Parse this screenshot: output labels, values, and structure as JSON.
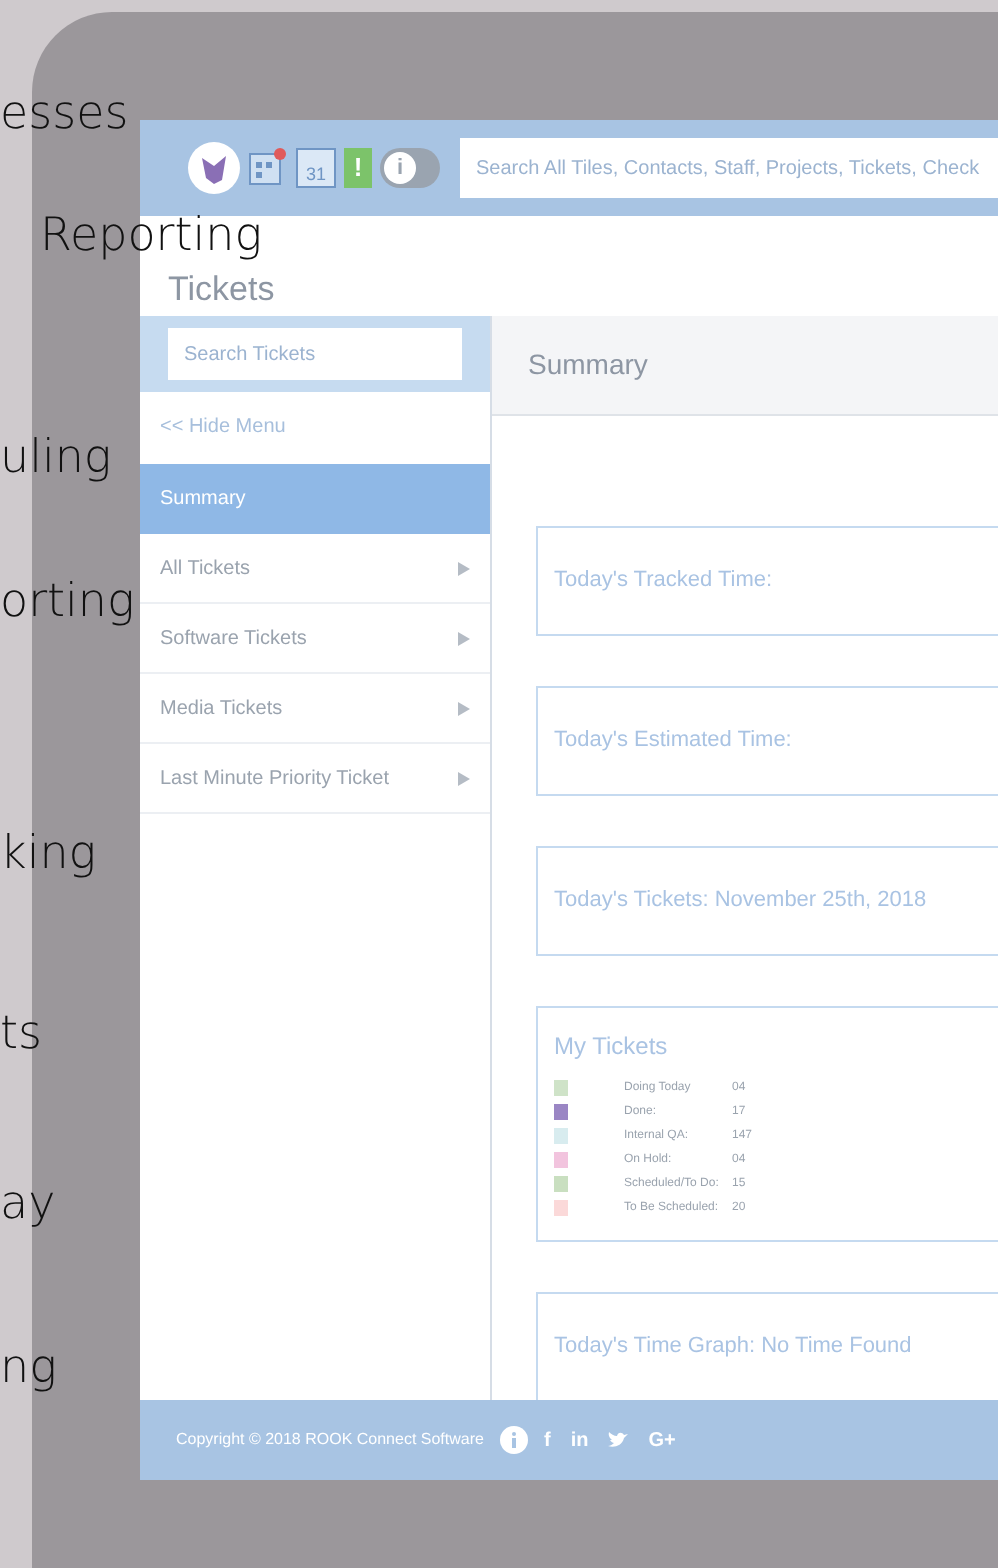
{
  "overlay_words": [
    "esses",
    "Reporting",
    "uling",
    "orting",
    "king",
    "ts",
    "ay",
    "ng"
  ],
  "top_bar": {
    "calendar_digit": "31",
    "alert_mark": "!",
    "info_mark": "i",
    "search": {
      "placeholder": "Search All Tiles, Contacts, Staff, Projects, Tickets, Check"
    }
  },
  "page_title": "Tickets",
  "sidebar": {
    "search": {
      "placeholder": "Search Tickets"
    },
    "hide_menu": "<< Hide Menu",
    "items": [
      {
        "label": "Summary",
        "selected": true,
        "has_submenu": false
      },
      {
        "label": "All Tickets",
        "selected": false,
        "has_submenu": true
      },
      {
        "label": "Software Tickets",
        "selected": false,
        "has_submenu": true
      },
      {
        "label": "Media Tickets",
        "selected": false,
        "has_submenu": true
      },
      {
        "label": "Last Minute Priority Ticket",
        "selected": false,
        "has_submenu": true
      }
    ]
  },
  "main": {
    "header": "Summary",
    "cards": [
      {
        "kind": "title",
        "title": "Today's Tracked Time:"
      },
      {
        "kind": "title",
        "title": "Today's Estimated Time:"
      },
      {
        "kind": "title",
        "title": "Today's Tickets: November 25th, 2018"
      },
      {
        "kind": "legend",
        "title": "My Tickets",
        "rows": [
          {
            "label": "Doing Today",
            "count": "04",
            "color": "#cfe3c8"
          },
          {
            "label": "Done:",
            "count": "17",
            "color": "#9a86c4"
          },
          {
            "label": "Internal QA:",
            "count": "147",
            "color": "#d8ecef"
          },
          {
            "label": "On Hold:",
            "count": "04",
            "color": "#f2c4de"
          },
          {
            "label": "Scheduled/To Do:",
            "count": "15",
            "color": "#c9dfc0"
          },
          {
            "label": "To Be Scheduled:",
            "count": "20",
            "color": "#fbd9d9"
          }
        ]
      },
      {
        "kind": "title",
        "title": "Today's Time Graph: No Time Found"
      }
    ]
  },
  "footer": {
    "copyright": "Copyright © 2018 ROOK Connect Software",
    "social": [
      "f",
      "in",
      "G+"
    ]
  }
}
